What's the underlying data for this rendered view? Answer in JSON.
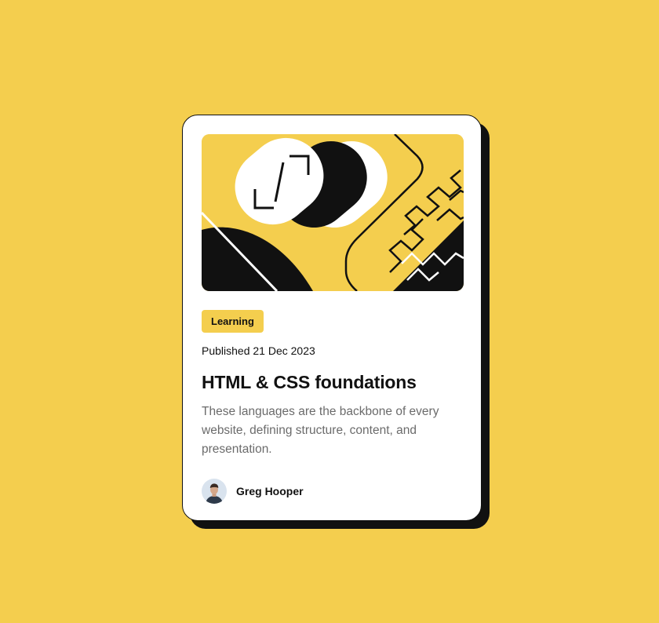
{
  "card": {
    "tag": "Learning",
    "published": "Published 21 Dec 2023",
    "title": "HTML & CSS foundations",
    "description": "These languages are the backbone of every website, defining structure, content, and presentation.",
    "author": {
      "name": "Greg Hooper",
      "avatar_icon": "person-avatar"
    },
    "hero_illustration": "abstract-shapes-illustration"
  },
  "colors": {
    "page_background": "#F4CE4E",
    "card_background": "#FFFFFF",
    "ink": "#111111",
    "muted_text": "#6B6B6B",
    "accent": "#F4CE4E"
  }
}
